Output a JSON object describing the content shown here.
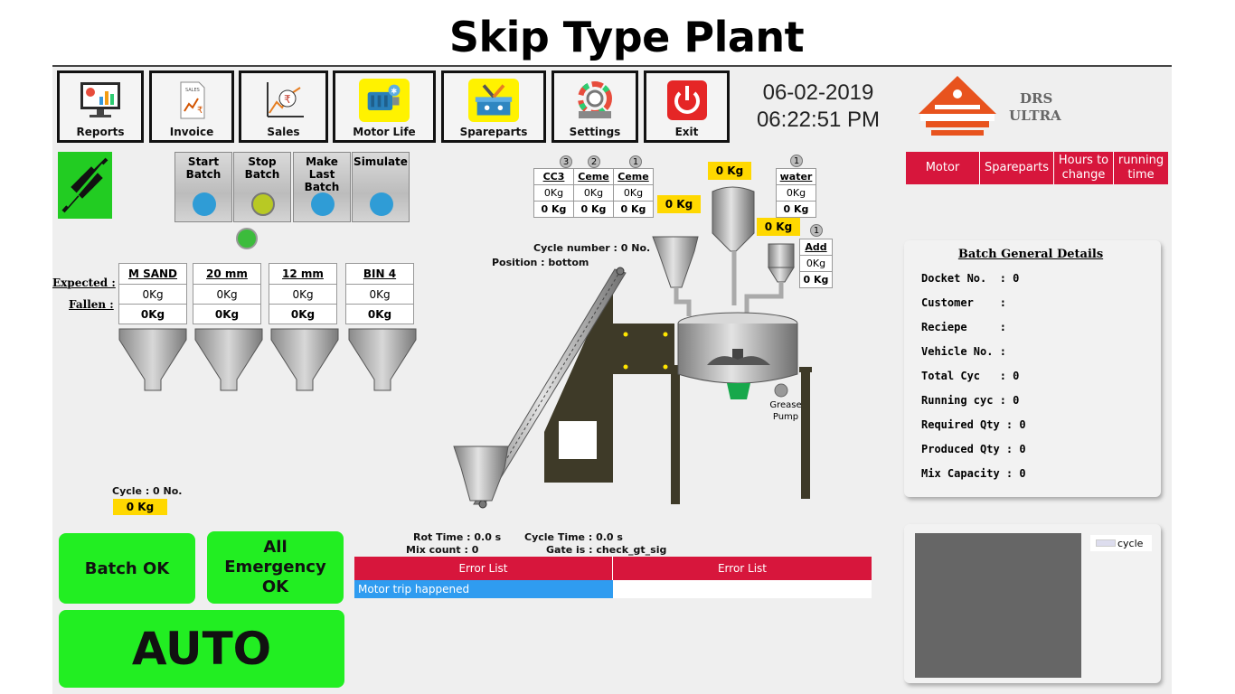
{
  "title": "Skip Type Plant",
  "toolbar": [
    {
      "label": "Reports",
      "icon": "reports-icon"
    },
    {
      "label": "Invoice",
      "icon": "invoice-icon"
    },
    {
      "label": "Sales",
      "icon": "sales-icon"
    },
    {
      "label": "Motor Life",
      "icon": "motor-life-icon"
    },
    {
      "label": "Spareparts",
      "icon": "spareparts-icon"
    },
    {
      "label": "Settings",
      "icon": "settings-icon"
    },
    {
      "label": "Exit",
      "icon": "power-icon"
    }
  ],
  "invoice_icon_text": "SALES",
  "datetime": {
    "date": "06-02-2019",
    "time": "06:22:51 PM"
  },
  "brand": {
    "line1": "DRS",
    "line2": "ULTRA"
  },
  "right_tabs": [
    "Motor",
    "Spareparts",
    "Hours to change",
    "running time"
  ],
  "batch_controls": [
    "Start Batch",
    "Stop Batch",
    "Make Last Batch",
    "Simulate"
  ],
  "aggregate_labels": {
    "expected": "Expected :",
    "fallen": "Fallen :"
  },
  "bins": [
    {
      "name": "M SAND",
      "expected": "0Kg",
      "fallen": "0Kg"
    },
    {
      "name": "20 mm",
      "expected": "0Kg",
      "fallen": "0Kg"
    },
    {
      "name": "12 mm",
      "expected": "0Kg",
      "fallen": "0Kg"
    },
    {
      "name": "BIN 4",
      "expected": "0Kg",
      "fallen": "0Kg"
    }
  ],
  "silos": [
    {
      "num": "3",
      "name": "CC3",
      "expected": "0Kg",
      "fallen": "0 Kg"
    },
    {
      "num": "2",
      "name": "Ceme",
      "expected": "0Kg",
      "fallen": "0 Kg"
    },
    {
      "num": "1",
      "name": "Ceme",
      "expected": "0Kg",
      "fallen": "0 Kg"
    }
  ],
  "water": {
    "num": "1",
    "name": "water",
    "expected": "0Kg",
    "fallen": "0 Kg"
  },
  "additive": {
    "num": "1",
    "name": "Add",
    "expected": "0Kg",
    "fallen": "0 Kg"
  },
  "weigh": {
    "cement_hopper": "0 Kg",
    "top": "0 Kg",
    "water": "0 Kg"
  },
  "cycle_number": "Cycle number : 0 No.",
  "position": "Position : bottom",
  "grease_pump": "Grease Pump",
  "cycle_count": "Cycle  : 0 No.",
  "cycle_kg": "0 Kg",
  "rot_time": "Rot Time : 0.0 s",
  "cycle_time": "Cycle Time : 0.0 s",
  "mix_count": "Mix count : 0",
  "gate": "Gate is : check_gt_sig",
  "error_headers": [
    "Error List",
    "Error List"
  ],
  "error_rows": [
    "Motor trip happened",
    ""
  ],
  "details": {
    "header": "Batch General Details",
    "rows": [
      "Docket No.  : 0",
      "Customer    :",
      "Reciepe     :",
      "Vehicle No. :",
      "Total Cyc   : 0",
      "Running cyc : 0",
      "Required Qty : 0",
      "Produced Qty : 0",
      "Mix Capacity : 0"
    ]
  },
  "graph_legend": "cycle",
  "status_buttons": {
    "batch_ok": "Batch OK",
    "emergency": "All Emergency OK",
    "mode": "AUTO"
  },
  "colors": {
    "accent_red": "#d7163c",
    "status_green": "#22ee22",
    "weight_yellow": "#ffd800",
    "machine_olive": "#3e3a28",
    "error_blue": "#2f9cf0"
  }
}
